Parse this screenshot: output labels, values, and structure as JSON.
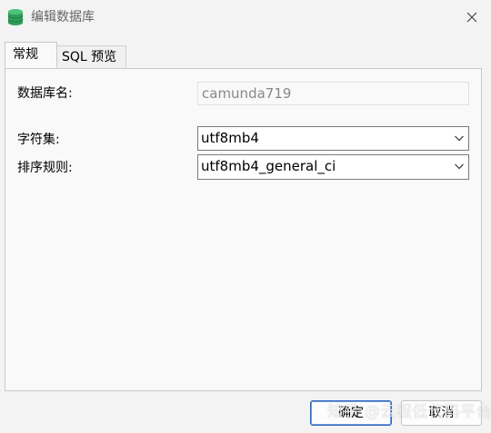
{
  "window": {
    "title": "编辑数据库",
    "icon": "database-icon",
    "close_icon": "close-icon"
  },
  "tabs": [
    {
      "label": "常规",
      "active": true
    },
    {
      "label": "SQL 预览",
      "active": false
    }
  ],
  "form": {
    "db_name_label": "数据库名:",
    "db_name_value": "camunda719",
    "charset_label": "字符集:",
    "charset_value": "utf8mb4",
    "collation_label": "排序规则:",
    "collation_value": "utf8mb4_general_ci"
  },
  "buttons": {
    "ok_label": "确定",
    "cancel_label": "取消"
  },
  "watermark": "知乎 @云程低代码平台",
  "colors": {
    "icon_green": "#2e9d5b",
    "focus_border": "#2f65b4"
  }
}
